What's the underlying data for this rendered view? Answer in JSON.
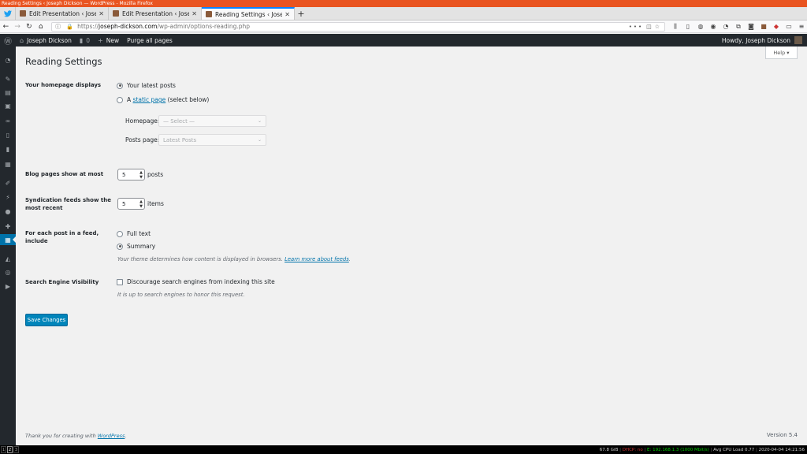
{
  "window_title": "Reading Settings ‹ Joseph Dickson — WordPress - Mozilla Firefox",
  "tabs": [
    {
      "label": "Edit Presentation ‹ Josep",
      "active": false
    },
    {
      "label": "Edit Presentation ‹ Josep",
      "active": false
    },
    {
      "label": "Reading Settings ‹ Josep",
      "active": true
    }
  ],
  "url": {
    "scheme": "https://",
    "host": "joseph-dickson.com",
    "path": "/wp-admin/options-reading.php"
  },
  "adminbar": {
    "site_name": "Joseph Dickson",
    "comments_count": "0",
    "new_label": "New",
    "purge_label": "Purge all pages",
    "howdy": "Howdy, Joseph Dickson"
  },
  "help_label": "Help ▾",
  "page": {
    "title": "Reading Settings",
    "homepage": {
      "label": "Your homepage displays",
      "option_latest": "Your latest posts",
      "option_static_prefix": "A ",
      "option_static_link": "static page",
      "option_static_suffix": " (select below)",
      "homepage_label": "Homepage:",
      "homepage_select": "— Select —",
      "posts_page_label": "Posts page:",
      "posts_page_select": "Latest Posts"
    },
    "blog_pages": {
      "label": "Blog pages show at most",
      "value": "5",
      "unit": "posts"
    },
    "syndication": {
      "label": "Syndication feeds show the most recent",
      "value": "5",
      "unit": "items"
    },
    "feed_content": {
      "label": "For each post in a feed, include",
      "option_full": "Full text",
      "option_summary": "Summary",
      "desc_prefix": "Your theme determines how content is displayed in browsers. ",
      "desc_link": "Learn more about feeds"
    },
    "search_visibility": {
      "label": "Search Engine Visibility",
      "checkbox_label": "Discourage search engines from indexing this site",
      "desc": "It is up to search engines to honor this request."
    },
    "save_label": "Save Changes"
  },
  "footer": {
    "thanks_prefix": "Thank you for creating with ",
    "thanks_link": "WordPress",
    "version": "Version 5.4"
  },
  "statusbar": {
    "workspaces": [
      "1",
      "2",
      "3"
    ],
    "disk": "67.8 GiB",
    "dhcp": "DHCP: no",
    "eth": "E: 192.168.1.3 (1000 Mbit/s)",
    "cpu": "Avg CPU Load 0.77",
    "datetime": "2020-04-04 14:21:56"
  },
  "colors": {
    "wp_blue": "#0073aa",
    "admin_dark": "#23282d",
    "ubuntu_orange": "#e95420",
    "firefox_blue": "#0a84ff"
  }
}
